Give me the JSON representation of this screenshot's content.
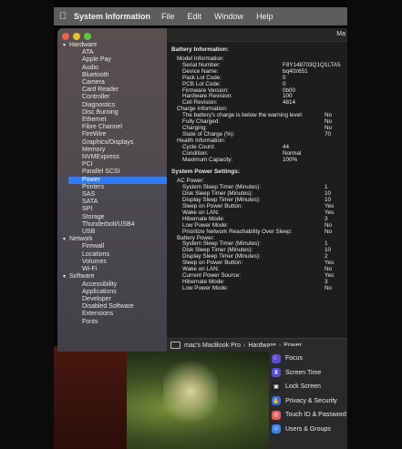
{
  "menubar": {
    "app_name": "System Information",
    "menus": [
      "File",
      "Edit",
      "Window",
      "Help"
    ]
  },
  "window": {
    "title_fragment": "Ma"
  },
  "sidebar": {
    "categories": [
      {
        "label": "Hardware",
        "items": [
          "ATA",
          "Apple Pay",
          "Audio",
          "Bluetooth",
          "Camera",
          "Card Reader",
          "Controller",
          "Diagnostics",
          "Disc Burning",
          "Ethernet",
          "Fibre Channel",
          "FireWire",
          "Graphics/Displays",
          "Memory",
          "NVMExpress",
          "PCI",
          "Parallel SCSI",
          "Power",
          "Printers",
          "SAS",
          "SATA",
          "SPI",
          "Storage",
          "Thunderbolt/USB4",
          "USB"
        ]
      },
      {
        "label": "Network",
        "items": [
          "Firewall",
          "Locations",
          "Volumes",
          "Wi-Fi"
        ]
      },
      {
        "label": "Software",
        "items": [
          "Accessibility",
          "Applications",
          "Developer",
          "Disabled Software",
          "Extensions",
          "Fonts"
        ]
      }
    ],
    "selected": "Power"
  },
  "content": {
    "battery_header": "Battery Information:",
    "model_header": "Model Information:",
    "model": [
      {
        "k": "Serial Number:",
        "v": "F8Y148703Q1Q1LTA5"
      },
      {
        "k": "Device Name:",
        "v": "bq40z651"
      },
      {
        "k": "Pack Lot Code:",
        "v": "0"
      },
      {
        "k": "PCB Lot Code:",
        "v": "0"
      },
      {
        "k": "Firmware Version:",
        "v": "0b00"
      },
      {
        "k": "Hardware Revision:",
        "v": "100"
      },
      {
        "k": "Cell Revision:",
        "v": "4814"
      }
    ],
    "charge_header": "Charge Information:",
    "charge": [
      {
        "k": "The battery's charge is below the warning level:",
        "v": "No"
      },
      {
        "k": "Fully Charged:",
        "v": "No"
      },
      {
        "k": "Charging:",
        "v": "No"
      },
      {
        "k": "State of Charge (%):",
        "v": "70"
      }
    ],
    "health_header": "Health Information:",
    "health": [
      {
        "k": "Cycle Count:",
        "v": "44"
      },
      {
        "k": "Condition:",
        "v": "Normal"
      },
      {
        "k": "Maximum Capacity:",
        "v": "100%"
      }
    ],
    "power_header": "System Power Settings:",
    "ac_header": "AC Power:",
    "ac": [
      {
        "k": "System Sleep Timer (Minutes):",
        "v": "1"
      },
      {
        "k": "Disk Sleep Timer (Minutes):",
        "v": "10"
      },
      {
        "k": "Display Sleep Timer (Minutes):",
        "v": "10"
      },
      {
        "k": "Sleep on Power Button:",
        "v": "Yes"
      },
      {
        "k": "Wake on LAN:",
        "v": "Yes"
      },
      {
        "k": "Hibernate Mode:",
        "v": "3"
      },
      {
        "k": "Low Power Mode:",
        "v": "No"
      },
      {
        "k": "Prioritize Network Reachability Over Sleep:",
        "v": "No"
      }
    ],
    "battery_power_header": "Battery Power:",
    "battery_power": [
      {
        "k": "System Sleep Timer (Minutes):",
        "v": "1"
      },
      {
        "k": "Disk Sleep Timer (Minutes):",
        "v": "10"
      },
      {
        "k": "Display Sleep Timer (Minutes):",
        "v": "2"
      },
      {
        "k": "Sleep on Power Button:",
        "v": "Yes"
      },
      {
        "k": "Wake on LAN:",
        "v": "No"
      },
      {
        "k": "Current Power Source:",
        "v": "Yes"
      },
      {
        "k": "Hibernate Mode:",
        "v": "3"
      },
      {
        "k": "Low Power Mode:",
        "v": "No"
      }
    ]
  },
  "pathbar": {
    "computer": "mac's MacBook Pro",
    "section": "Hardware",
    "item": "Power"
  },
  "settings_panel": {
    "items": [
      {
        "label": "Focus",
        "icon": "moon-icon",
        "color": "#5a4fcf"
      },
      {
        "label": "Screen Time",
        "icon": "hourglass-icon",
        "color": "#5a4fcf"
      },
      {
        "label": "Lock Screen",
        "icon": "lock-icon",
        "color": "#222222"
      },
      {
        "label": "Privacy & Security",
        "icon": "hand-icon",
        "color": "#2f6fe0"
      },
      {
        "label": "Touch ID & Password",
        "icon": "fingerprint-icon",
        "color": "#e85d5d"
      },
      {
        "label": "Users & Groups",
        "icon": "users-icon",
        "color": "#3a86e8"
      }
    ]
  }
}
